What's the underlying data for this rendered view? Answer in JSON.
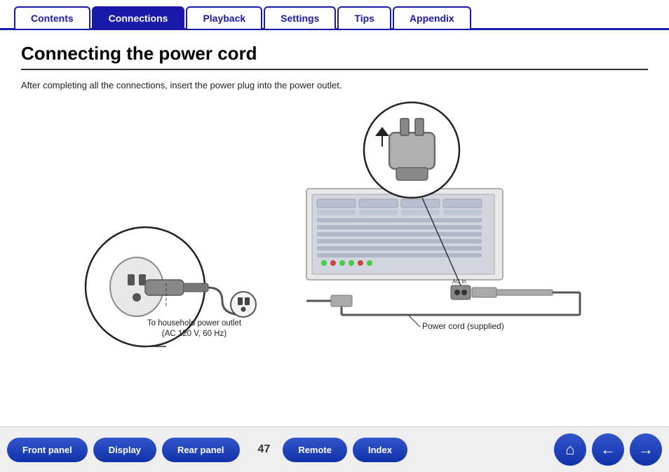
{
  "nav": {
    "tabs": [
      {
        "label": "Contents",
        "active": false
      },
      {
        "label": "Connections",
        "active": true
      },
      {
        "label": "Playback",
        "active": false
      },
      {
        "label": "Settings",
        "active": false
      },
      {
        "label": "Tips",
        "active": false
      },
      {
        "label": "Appendix",
        "active": false
      }
    ]
  },
  "main": {
    "title": "Connecting the power cord",
    "description": "After completing all the connections, insert the power plug into the power outlet.",
    "diagram_label_outlet": "To household power outlet",
    "diagram_label_outlet2": "(AC 120 V, 60 Hz)",
    "diagram_label_cord": "Power cord (supplied)"
  },
  "bottom": {
    "page_number": "47",
    "buttons": [
      {
        "label": "Front panel",
        "id": "front-panel"
      },
      {
        "label": "Display",
        "id": "display"
      },
      {
        "label": "Rear panel",
        "id": "rear-panel"
      },
      {
        "label": "Remote",
        "id": "remote"
      },
      {
        "label": "Index",
        "id": "index"
      }
    ],
    "icons": [
      {
        "label": "home",
        "symbol": "⌂"
      },
      {
        "label": "back",
        "symbol": "←"
      },
      {
        "label": "forward",
        "symbol": "→"
      }
    ]
  }
}
